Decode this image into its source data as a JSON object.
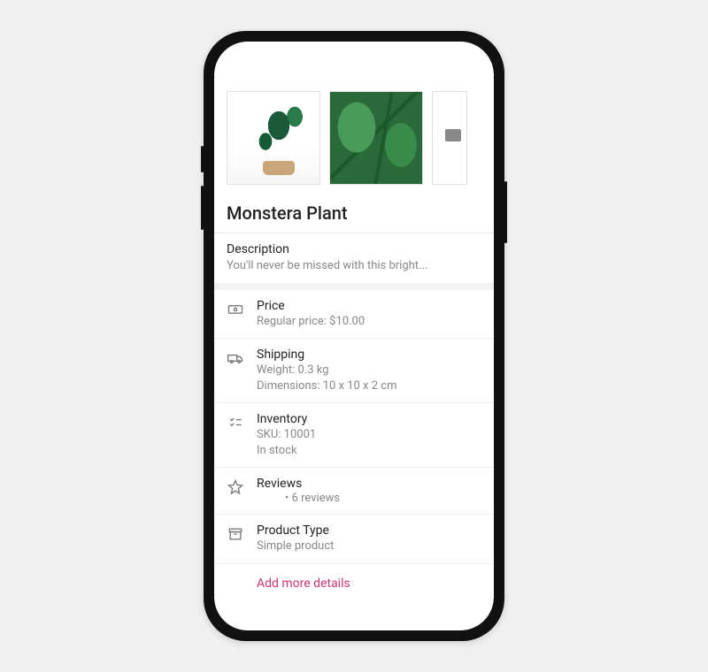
{
  "product": {
    "title": "Monstera Plant",
    "description": {
      "label": "Description",
      "text": "You'll never be missed with this bright..."
    },
    "price": {
      "label": "Price",
      "line": "Regular price: $10.00"
    },
    "shipping": {
      "label": "Shipping",
      "weight": "Weight: 0.3 kg",
      "dimensions": "Dimensions: 10 x 10 x 2 cm"
    },
    "inventory": {
      "label": "Inventory",
      "sku": "SKU: 10001",
      "stock": "In stock"
    },
    "reviews": {
      "label": "Reviews",
      "count_line": "• 6 reviews"
    },
    "type": {
      "label": "Product Type",
      "value": "Simple product"
    }
  },
  "actions": {
    "add_more": "Add more details"
  },
  "accent_color": "#c9356e"
}
